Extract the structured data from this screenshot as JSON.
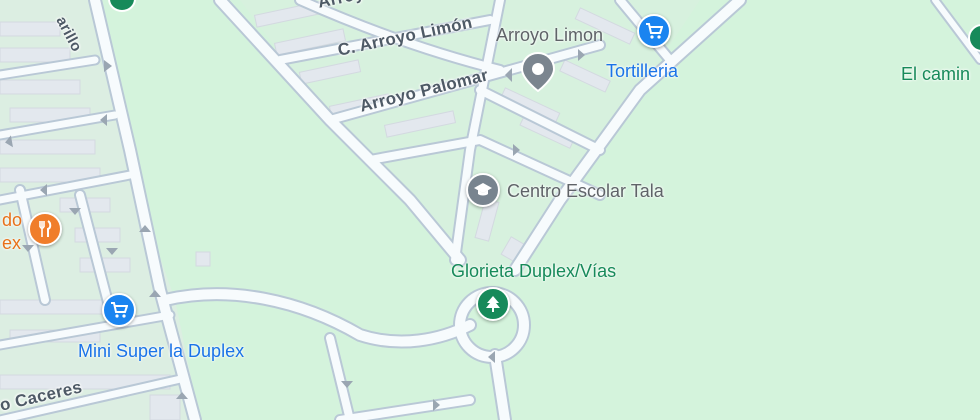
{
  "map": {
    "colors": {
      "park": "#d4f3dc",
      "road_casing": "#b9c8d6",
      "road_fill": "#f7fbfd",
      "building": "#e3e8ee",
      "shop_pin": "#1a84f0",
      "park_pin": "#178a5a",
      "school_pin": "#78848f",
      "restaurant_pin": "#f07d2a",
      "place_pin": "#7b858f"
    },
    "streets": {
      "arroyo_top": "Arroyo",
      "arroyo_limon": "C. Arroyo Limón",
      "arroyo_palomar": "Arroyo Palomar",
      "caceres": "o Caceres",
      "carrillo": "arillo"
    },
    "places": {
      "arroyo_limon": {
        "name": "Arroyo Limon",
        "icon": "place-pin-icon"
      },
      "tortilleria": {
        "name": "Tortilleria",
        "icon": "shopping-cart-icon"
      },
      "centro_escolar": {
        "name": "Centro Escolar Tala",
        "icon": "graduation-cap-icon"
      },
      "glorieta": {
        "name": "Glorieta Duplex/Vías",
        "icon": "tree-icon"
      },
      "mini_super": {
        "name": "Mini Super la Duplex",
        "icon": "shopping-cart-icon"
      },
      "restaurant_line1": "do",
      "restaurant_line2": "ex",
      "restaurant_icon": "fork-knife-icon",
      "el_camino": "El camin"
    }
  }
}
